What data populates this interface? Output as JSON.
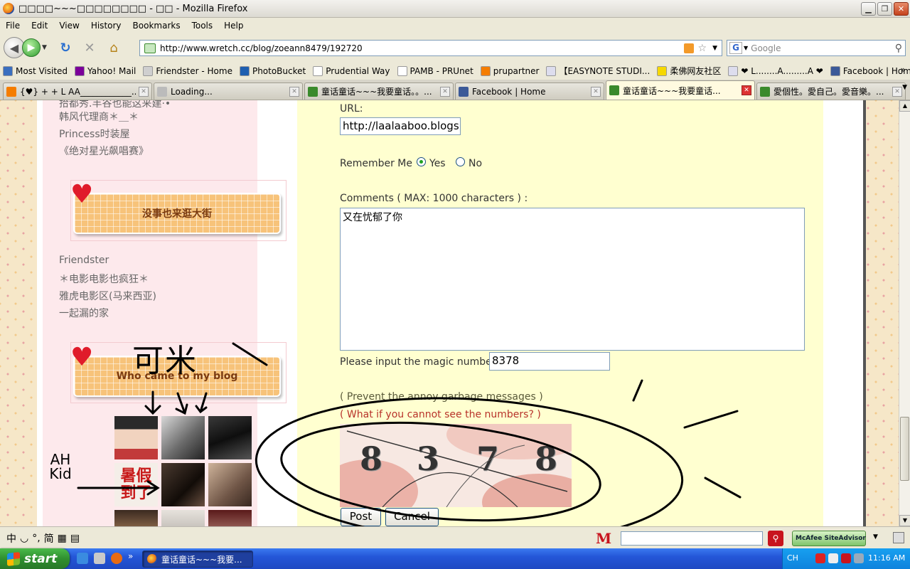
{
  "window": {
    "title": "□□□□~~~□□□□□□□□ - □□ - Mozilla Firefox"
  },
  "menu": {
    "items": [
      "File",
      "Edit",
      "View",
      "History",
      "Bookmarks",
      "Tools",
      "Help"
    ]
  },
  "nav": {
    "url": "http://www.wretch.cc/blog/zoeann8479/192720",
    "search_placeholder": "Google",
    "search_engine": "G"
  },
  "bookmarks": [
    {
      "label": "Most Visited",
      "color": "#3a6fbf"
    },
    {
      "label": "Yahoo! Mail",
      "color": "#7b0099"
    },
    {
      "label": "Friendster - Home",
      "color": "#cfcfcf"
    },
    {
      "label": "PhotoBucket",
      "color": "#1e5fb0"
    },
    {
      "label": "Prudential Way",
      "color": "#ffffff"
    },
    {
      "label": "PAMB - PRUnet",
      "color": "#ffffff"
    },
    {
      "label": "prupartner",
      "color": "#f57d00"
    },
    {
      "label": "【EASYNOTE STUDI...",
      "color": "#dde"
    },
    {
      "label": "柔佛网友社区",
      "color": "#f6d800"
    },
    {
      "label": "❤ L........A.........A ❤",
      "color": "#dde"
    },
    {
      "label": "Facebook | Home",
      "color": "#3b5998"
    }
  ],
  "tabs": [
    {
      "label": "{♥} + + L AA____________...",
      "color": "#f57d00"
    },
    {
      "label": "Loading...",
      "color": "#bbbbbb"
    },
    {
      "label": "童话童话~~~我要童话。。...",
      "color": "#3a8a2c"
    },
    {
      "label": "Facebook | Home",
      "color": "#3b5998"
    },
    {
      "label": "童话童话~~~我要童话...",
      "color": "#3a8a2c"
    },
    {
      "label": "愛個性。愛自己。愛音樂。...",
      "color": "#3a8a2c"
    }
  ],
  "sidebar": {
    "cut_link": "拾都秀.丰谷也能这来建·•",
    "links_group1": [
      "韩风代理商＊＿＊",
      "Princess时装屋",
      "《绝对星光飙唱赛》"
    ],
    "banner1": "没事也来逛大街",
    "links_group2": [
      "Friendster",
      "＊电影电影也疯狂＊",
      "雅虎电影区(马来西亚)",
      "一起漏的家"
    ],
    "banner2": "Who came to my blog",
    "avatar_badge": "暑假到了"
  },
  "form": {
    "url_label": "URL:",
    "url_value": "http://laalaaboo.blogspot.com",
    "remember_label": "Remember Me",
    "yes_label": "Yes",
    "no_label": "No",
    "comments_label": "Comments ( MAX: 1000 characters ) :",
    "comments_value": "又在忧郁了你",
    "magic_label": "Please input the magic number:",
    "magic_value": "8378",
    "prevent_text": "( Prevent the annoy garbage messages )",
    "cannot_see_text": "( What if you cannot see the numbers? )",
    "captcha_digits": [
      "8",
      "3",
      "7",
      "8"
    ],
    "post_label": "Post",
    "cancel_label": "Cancel"
  },
  "annotations": {
    "chinese": "可米",
    "english": "AH Kid"
  },
  "findbar": {
    "ime": [
      "中",
      "◡",
      "°,",
      "简",
      "▦",
      "▤"
    ],
    "siteadvisor": "McAfee SiteAdvisor",
    "mcafee": "M"
  },
  "taskbar": {
    "start": "start",
    "task": "童话童话~~~我要...",
    "lang": "CH",
    "clock": "11:16 AM"
  }
}
